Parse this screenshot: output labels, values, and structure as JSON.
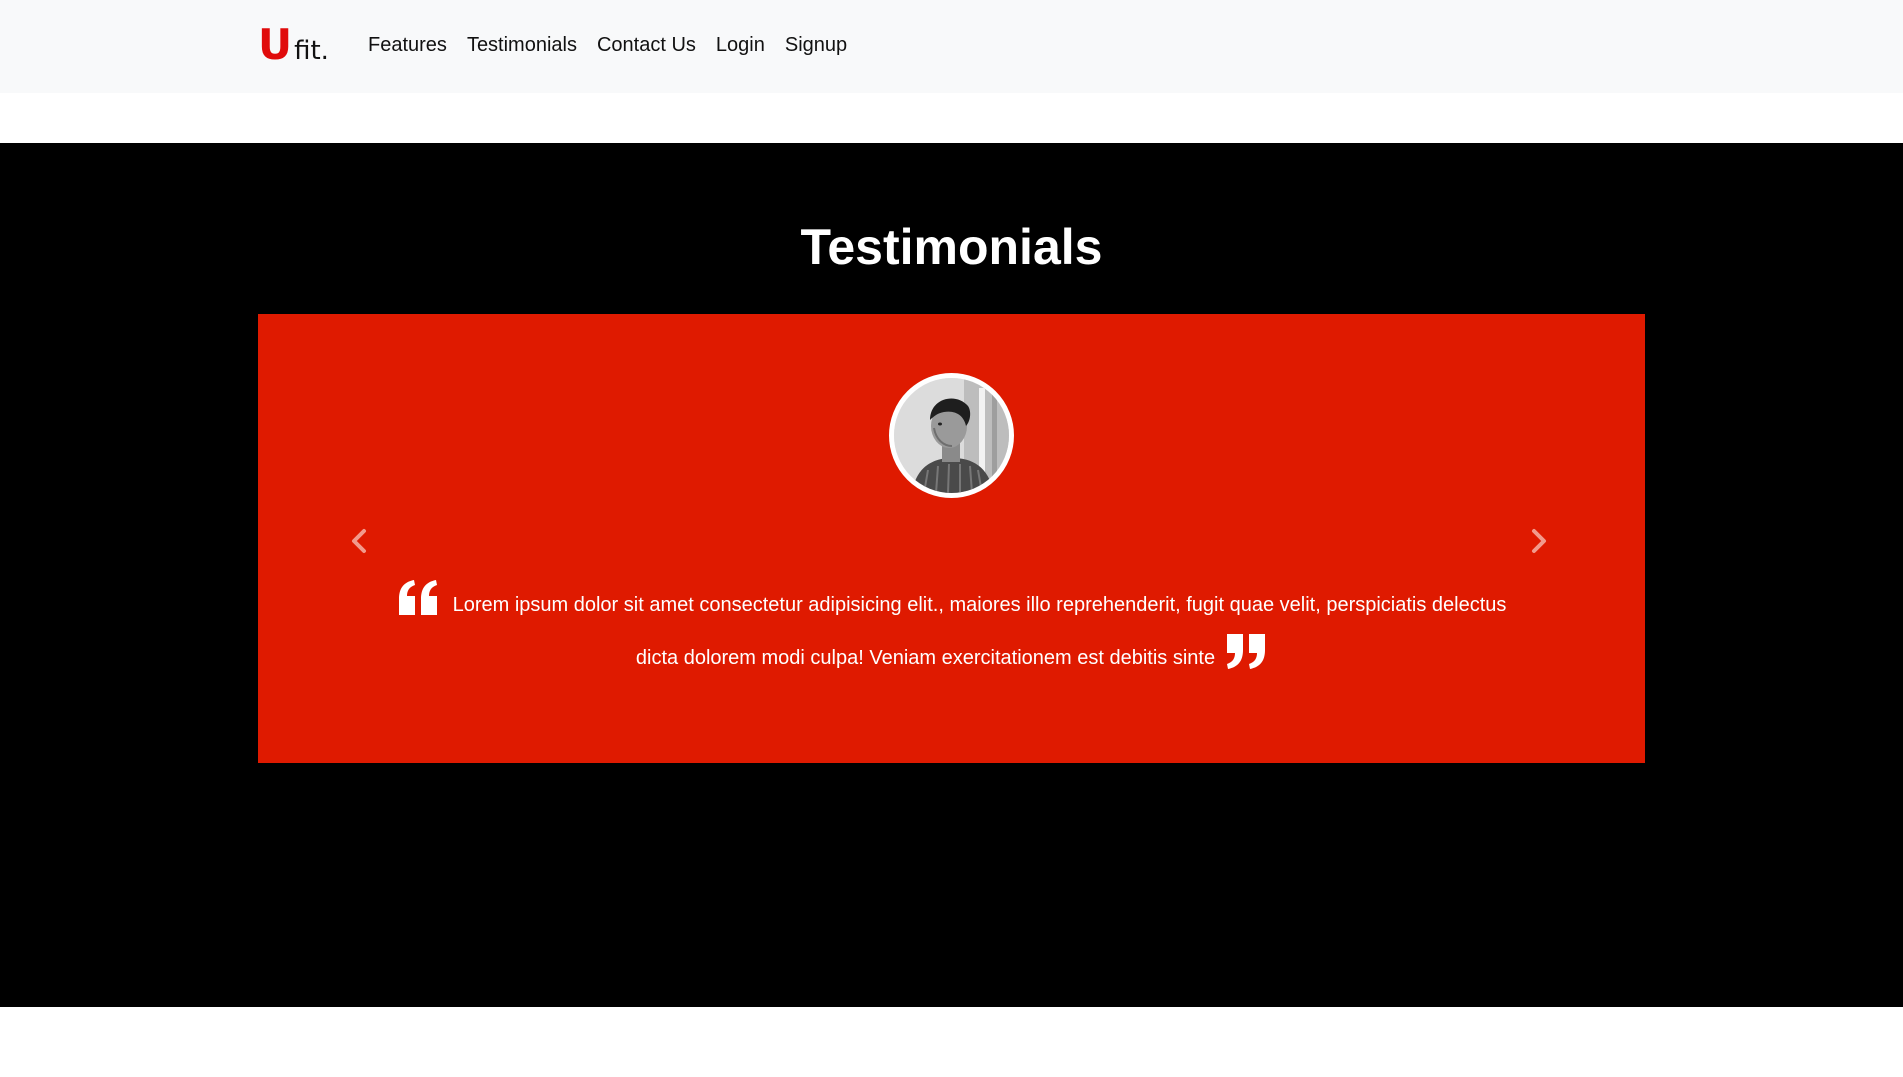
{
  "navbar": {
    "brand_letter": "U",
    "brand_rest": "fit.",
    "brand_color": "#e00b0b",
    "links": [
      {
        "label": "Features"
      },
      {
        "label": "Testimonials"
      },
      {
        "label": "Contact Us"
      },
      {
        "label": "Login"
      },
      {
        "label": "Signup"
      }
    ]
  },
  "testimonials": {
    "title": "Testimonials",
    "background_color": "#000000",
    "card_color": "#df1a00",
    "quote_text": "Lorem ipsum dolor sit amet consectetur adipisicing elit., maiores illo reprehenderit, fugit quae velit, perspiciatis delectus dicta dolorem modi culpa! Veniam exercitationem est debitis sinte",
    "avatar_icon": "person-photo",
    "prev_icon": "chevron-left-icon",
    "next_icon": "chevron-right-icon",
    "quote_open_icon": "quote-left-icon",
    "quote_close_icon": "quote-right-icon"
  }
}
